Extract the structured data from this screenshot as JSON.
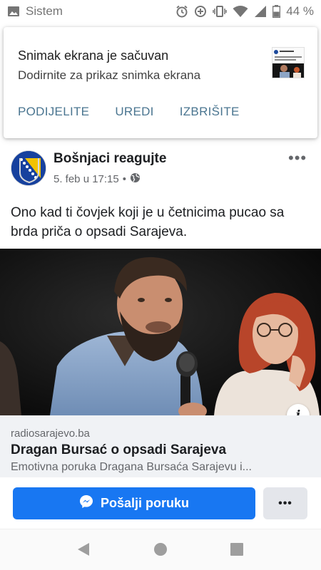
{
  "status_bar": {
    "app_name": "Sistem",
    "battery": "44 %"
  },
  "notification": {
    "title": "Snimak ekrana je sačuvan",
    "subtitle": "Dodirnite za prikaz snimka ekrana",
    "actions": [
      "PODIJELITE",
      "UREDI",
      "IZBRIŠITE"
    ]
  },
  "post": {
    "page_name": "Bošnjaci reagujte",
    "date": "5. feb u 17:15",
    "separator": "•",
    "more_label": "•••",
    "text": "Ono kad ti čovjek koji je u četnicima pucao sa brda priča o opsadi Sarajeva."
  },
  "link_preview": {
    "domain": "radiosarajevo.ba",
    "title": "Dragan Bursać o opsadi Sarajeva",
    "description": "Emotivna poruka Dragana Bursaća Sarajevu i...",
    "info_label": "i"
  },
  "cta": {
    "send_label": "Pošalji poruku",
    "more_label": "•••"
  },
  "colors": {
    "accent": "#1877f2",
    "notif_action": "#4a7590"
  }
}
